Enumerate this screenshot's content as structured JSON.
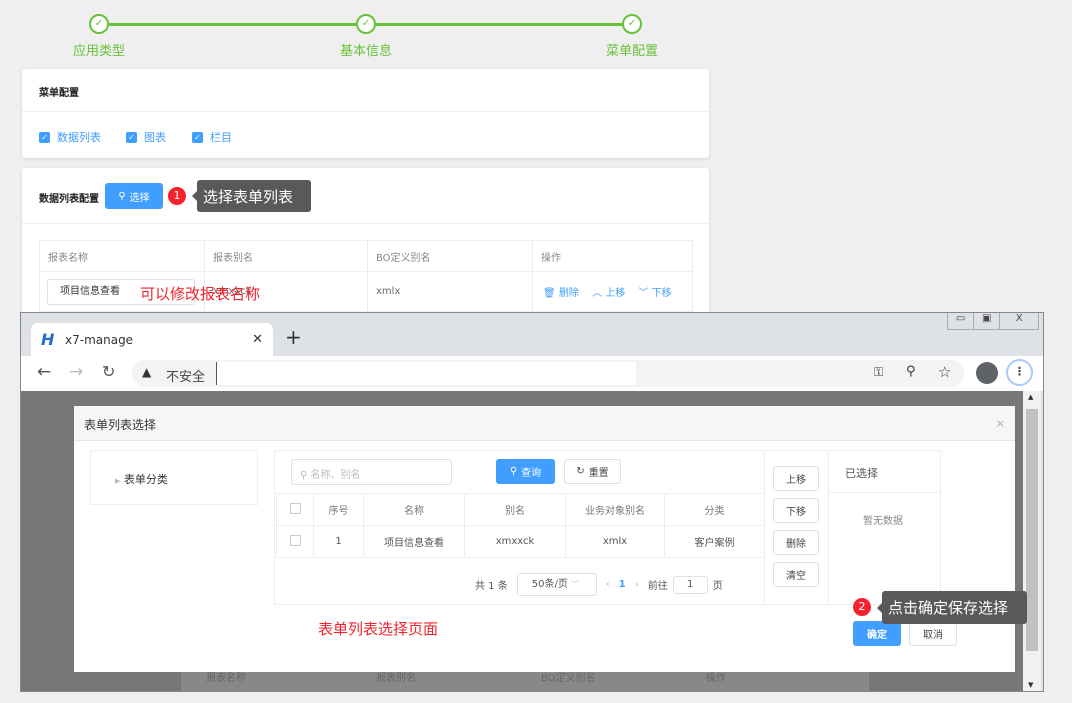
{
  "steps": [
    {
      "label": "应用类型"
    },
    {
      "label": "基本信息"
    },
    {
      "label": "菜单配置"
    }
  ],
  "menu_card": {
    "title": "菜单配置",
    "checkboxes": [
      {
        "label": "数据列表",
        "checked": true
      },
      {
        "label": "图表",
        "checked": true
      },
      {
        "label": "栏目",
        "checked": true
      }
    ]
  },
  "list_card": {
    "title": "数据列表配置",
    "select_button": "选择",
    "annotation1_num": "1",
    "annotation1_text": "选择表单列表",
    "columns": [
      "报表名称",
      "报表别名",
      "BO定义别名",
      "操作"
    ],
    "row": {
      "name": "项目信息查看",
      "alias": "xmxxck",
      "bo_alias": "xmlx",
      "actions": [
        "删除",
        "上移",
        "下移"
      ]
    },
    "annotation_edit": "可以修改报表名称"
  },
  "browser": {
    "tab_title": "x7-manage",
    "new_tab": "+",
    "security_text": "不安全"
  },
  "modal": {
    "title": "表单列表选择",
    "tree_item": "表单分类",
    "search_placeholder": "名称、别名",
    "query_button": "查询",
    "reset_button": "重置",
    "columns": [
      "序号",
      "名称",
      "别名",
      "业务对象别名",
      "分类"
    ],
    "rows": [
      {
        "index": "1",
        "name": "项目信息查看",
        "alias": "xmxxck",
        "bo_alias": "xmlx",
        "category": "客户案例"
      }
    ],
    "pagination": {
      "total": "共 1 条",
      "page_size": "50条/页",
      "current_page": "1",
      "goto_label": "前往",
      "goto_value": "1",
      "page_suffix": "页"
    },
    "side_buttons": [
      "上移",
      "下移",
      "删除",
      "清空"
    ],
    "selected_title": "已选择",
    "empty_text": "暂无数据",
    "confirm_button": "确定",
    "cancel_button": "取消",
    "annotation_page": "表单列表选择页面",
    "annotation2_num": "2",
    "annotation2_text": "点击确定保存选择"
  },
  "behind_columns": [
    "报表名称",
    "报表别名",
    "BO定义别名",
    "操作"
  ]
}
